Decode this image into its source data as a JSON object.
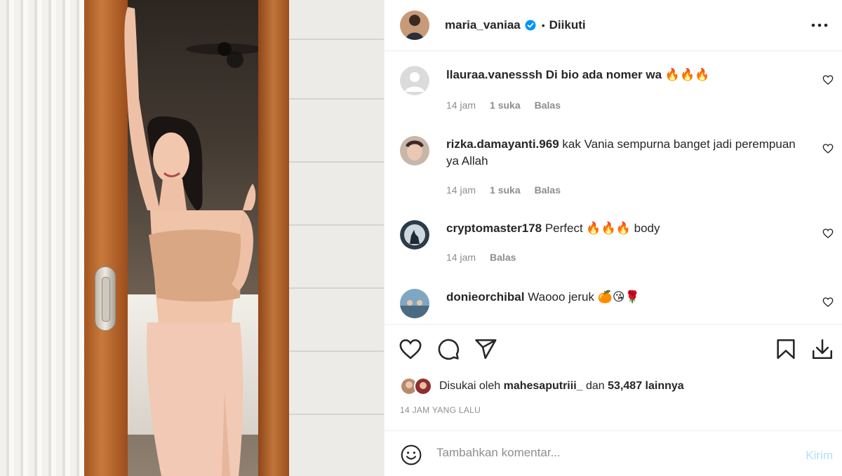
{
  "post": {
    "username": "maria_vaniaa",
    "follow_status": "Diikuti",
    "dot": "•"
  },
  "comments": [
    {
      "username": "llauraa.vanesssh",
      "text": "Di bio ada nomer wa 🔥🔥🔥",
      "time": "14 jam",
      "likes": "1 suka",
      "reply": "Balas"
    },
    {
      "username": "rizka.damayanti.969",
      "text": "kak Vania sempurna banget jadi perempuan ya Allah",
      "time": "14 jam",
      "likes": "1 suka",
      "reply": "Balas"
    },
    {
      "username": "cryptomaster178",
      "text": "Perfect 🔥🔥🔥 body",
      "time": "14 jam",
      "reply": "Balas"
    },
    {
      "username": "donieorchibal",
      "text": "Waooo jeruk 🍊😘🌹"
    }
  ],
  "likes": {
    "prefix": "Disukai oleh",
    "user": "mahesaputriii_",
    "middle": "dan",
    "count": "53,487 lainnya"
  },
  "timestamp": "14 JAM YANG LALU",
  "composer": {
    "placeholder": "Tambahkan komentar...",
    "send_label": "Kirim"
  },
  "icons": {
    "verified": "verified-badge-icon",
    "more": "more-options-icon",
    "heart": "heart-icon",
    "comment": "comment-icon",
    "share": "share-icon",
    "save": "bookmark-icon",
    "download": "download-icon",
    "emoji": "emoji-icon"
  },
  "colors": {
    "accent_blue": "#0095f6",
    "send_disabled": "#b2dffc",
    "muted_text": "#8e8e8e"
  }
}
